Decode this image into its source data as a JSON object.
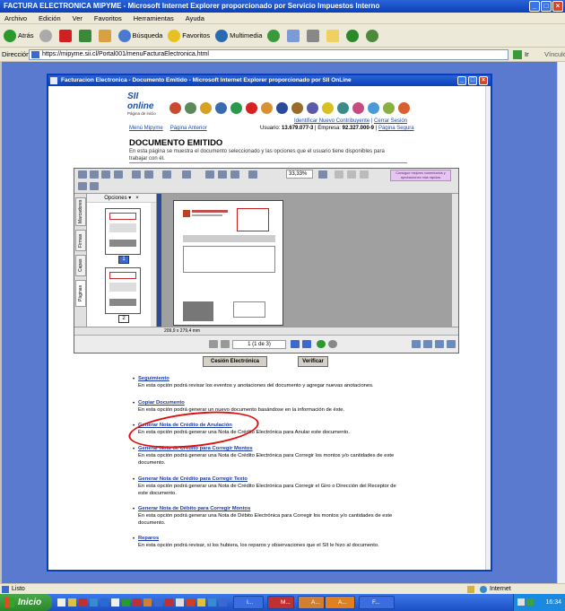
{
  "window": {
    "title": "FACTURA ELECTRONICA MIPYME - Microsoft Internet Explorer proporcionado por Servicio Impuestos Interno"
  },
  "menu": [
    "Archivo",
    "Edición",
    "Ver",
    "Favoritos",
    "Herramientas",
    "Ayuda"
  ],
  "toolbar": {
    "back": "Atrás",
    "search": "Búsqueda",
    "favorites": "Favoritos",
    "multimedia": "Multimedia"
  },
  "address": {
    "label": "Dirección",
    "url": "https://mipyme.sii.cl/Portal001/menuFacturaElectronica.html",
    "go": "Ir",
    "links": "Vínculos"
  },
  "inner_window": {
    "title": "Facturacion Electronica - Documento Emitido - Microsoft Internet Explorer proporcionado por SII OnLine"
  },
  "logo": {
    "name": "SII online",
    "sub": "Página de inicio"
  },
  "header": {
    "link_identify": "Identificar Nuevo Contribuyente",
    "link_close": "Cerrar Sesión",
    "user_label": "Usuario:",
    "user_value": "13.679.077-3",
    "company_label": "Empresa:",
    "company_value": "92.327.000-9",
    "secure_page": "Página Segura",
    "nav_menu": "Menú Mipyme",
    "nav_prev": "Página Anterior"
  },
  "page": {
    "title": "DOCUMENTO EMITIDO",
    "description": "En esta página se muestra el documento seleccionado y las opciones que el usuario tiene disponibles para trabajar con él."
  },
  "pdf": {
    "zoom": "33,33%",
    "note": "Consigue mejores comentarios y aprobaciones más rápidas",
    "options_label": "Opciones",
    "tabs": [
      "Marcadores",
      "Firmas",
      "Capas",
      "Páginas"
    ],
    "thumb_pages": [
      "1",
      "2"
    ],
    "page_size": "209,9 x 279,4 mm",
    "page_indicator": "1 (1 de 3)"
  },
  "buttons": {
    "electronic_session": "Cesión Electrónica",
    "verify": "Verificar"
  },
  "options": [
    {
      "title": "Seguimiento",
      "desc": "En esta opción podrá revisar los eventos y anotaciones del documento y agregar nuevas anotaciones."
    },
    {
      "title": "Copiar Documento",
      "desc": "En esta opción podrá generar un nuevo documento basándose en la información de éste."
    },
    {
      "title": "Generar Nota de Crédito de Anulación",
      "desc": "En esta opción podrá generar una Nota de Crédito Electrónica para Anular este documento."
    },
    {
      "title": "Generar Nota de Crédito para Corregir Montos",
      "desc": "En esta opción podrá generar una Nota de Crédito Electrónica para Corregir los montos y/o cantidades de este documento."
    },
    {
      "title": "Generar Nota de Crédito para Corregir Texto",
      "desc": "En esta opción podrá generar una Nota de Crédito Electrónica para Corregir el Giro o Dirección del Receptor de este documento."
    },
    {
      "title": "Generar Nota de Débito para Corregir Montos",
      "desc": "En esta opción podrá generar una Nota de Débito Electrónica para Corregir los montos y/o cantidades de este documento."
    },
    {
      "title": "Reparos",
      "desc": "En esta opción podrá revisar, si los hubiera, los reparos y observaciones que el SII le hizo al documento."
    }
  ],
  "status": {
    "left": "Listo",
    "zone": "Internet"
  },
  "taskbar": {
    "start": "Inicio",
    "tasks": [
      "I...",
      "M...",
      "A...",
      "A...",
      "F..."
    ],
    "clock": "16:34"
  }
}
